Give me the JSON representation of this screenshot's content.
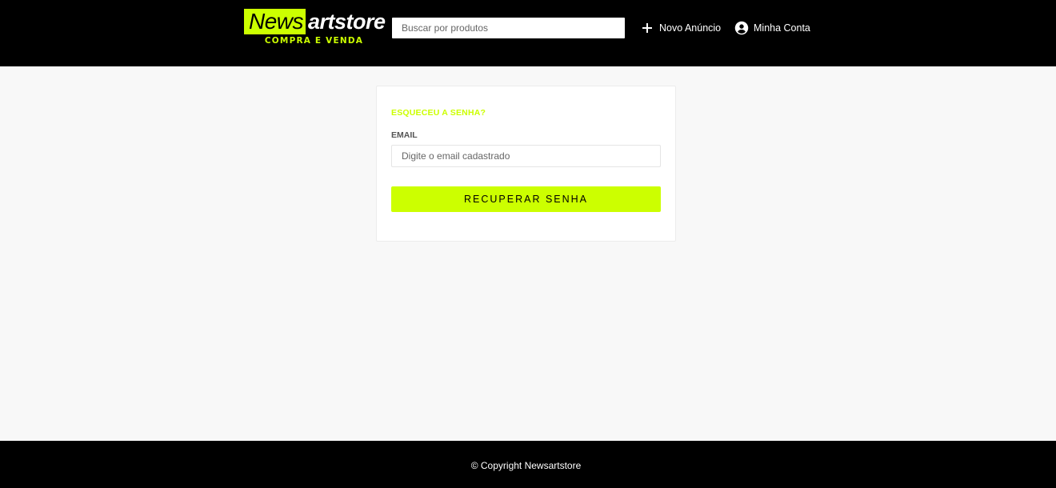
{
  "header": {
    "logo": {
      "part1": "News",
      "part2": "artstore",
      "tagline": "COMPRA E VENDA"
    },
    "search": {
      "placeholder": "Buscar por produtos",
      "value": ""
    },
    "nav": {
      "novo_anuncio": "Novo Anúncio",
      "minha_conta": "Minha Conta"
    }
  },
  "form": {
    "title": "ESQUECEU A SENHA?",
    "email_label": "EMAIL",
    "email_placeholder": "Digite o email cadastrado",
    "email_value": "",
    "submit_label": "RECUPERAR SENHA"
  },
  "footer": {
    "copyright": "© Copyright Newsartstore"
  },
  "colors": {
    "accent": "#ccff00",
    "header_bg": "#000000",
    "page_bg": "#f8f8f8"
  },
  "icons": {
    "novo_anuncio": "plus-icon",
    "minha_conta": "account-circle-icon"
  }
}
